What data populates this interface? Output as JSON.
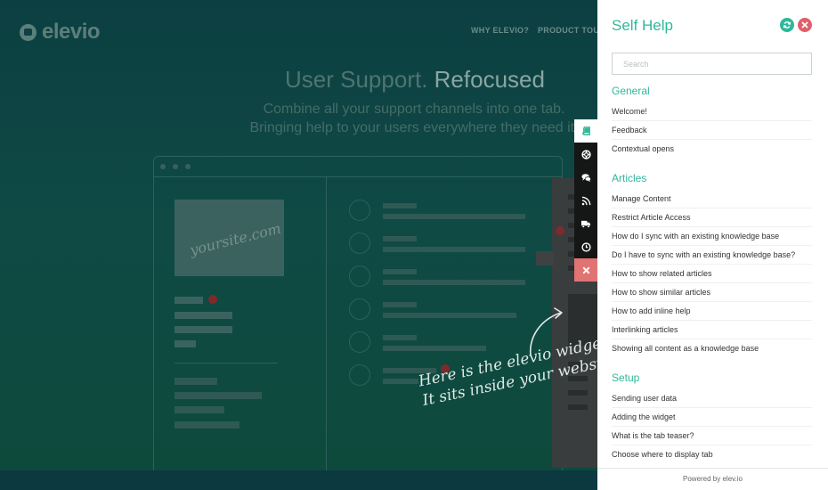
{
  "site": {
    "logo_text": "elevio",
    "nav": [
      "WHY ELEVIO?",
      "PRODUCT TOUR"
    ],
    "hero_title_light": "User Support.",
    "hero_title_bold": "Refocused",
    "hero_sub_1": "Combine all your support channels into one tab.",
    "hero_sub_2": "Bringing help to your users everywhere they need it.",
    "mock_site_label": "yoursite.com",
    "annotation_1": "Here is the elevio widget.",
    "annotation_2": "It sits inside your website."
  },
  "tabs": [
    {
      "icon": "book-icon",
      "state": "active"
    },
    {
      "icon": "lifebuoy-icon",
      "state": "normal"
    },
    {
      "icon": "chat-icon",
      "state": "normal"
    },
    {
      "icon": "rss-icon",
      "state": "normal"
    },
    {
      "icon": "truck-icon",
      "state": "normal"
    },
    {
      "icon": "clock-icon",
      "state": "normal"
    },
    {
      "icon": "close-icon",
      "state": "close"
    }
  ],
  "panel": {
    "title": "Self Help",
    "search_placeholder": "Search",
    "footer": "Powered by elev.io",
    "sections": [
      {
        "title": "General",
        "items": [
          "Welcome!",
          "Feedback",
          "Contextual opens"
        ]
      },
      {
        "title": "Articles",
        "items": [
          "Manage Content",
          "Restrict Article Access",
          "How do I sync with an existing knowledge base",
          "Do I have to sync with an existing knowledge base?",
          "How to show related articles",
          "How to show similar articles",
          "How to add inline help",
          "Interlinking articles",
          "Showing all content as a knowledge base"
        ]
      },
      {
        "title": "Setup",
        "items": [
          "Sending user data",
          "Adding the widget",
          "What is the tab teaser?",
          "Choose where to display tab"
        ]
      }
    ]
  },
  "colors": {
    "accent": "#2fb89a",
    "close": "#e0606a",
    "background": "#0f4a45"
  }
}
